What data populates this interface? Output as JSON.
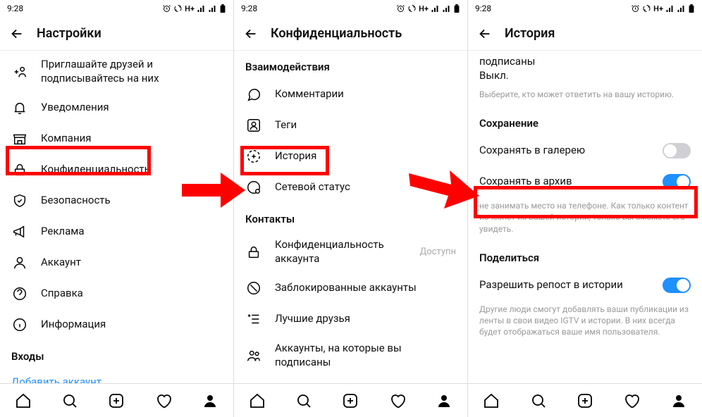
{
  "status": {
    "time": "9:28",
    "net": "H+"
  },
  "screen1": {
    "title": "Настройки",
    "rows": [
      {
        "label": "Приглашайте друзей и подписывайтесь на них"
      },
      {
        "label": "Уведомления"
      },
      {
        "label": "Компания"
      },
      {
        "label": "Конфиденциальность"
      },
      {
        "label": "Безопасность"
      },
      {
        "label": "Реклама"
      },
      {
        "label": "Аккаунт"
      },
      {
        "label": "Справка"
      },
      {
        "label": "Информация"
      }
    ],
    "logins_header": "Входы",
    "add_account": "Добавить аккаунт"
  },
  "screen2": {
    "title": "Конфиденциальность",
    "section_interactions": "Взаимодействия",
    "rows_i": [
      {
        "label": "Комментарии"
      },
      {
        "label": "Теги"
      },
      {
        "label": "История"
      },
      {
        "label": "Сетевой статус"
      }
    ],
    "section_contacts": "Контакты",
    "rows_c": [
      {
        "label": "Конфиденциальность аккаунта",
        "trailing": "Доступн"
      },
      {
        "label": "Заблокированные аккаунты"
      },
      {
        "label": "Лучшие друзья"
      },
      {
        "label": "Аккаунты, на которые вы подписаны"
      }
    ]
  },
  "screen3": {
    "title": "История",
    "top_cut": "подписаны",
    "top_val": "Выкл.",
    "top_hint": "Выберите, кто может ответить на вашу историю.",
    "section_save": "Сохранение",
    "save_gallery": "Сохранять в галерею",
    "save_archive": "Сохранять в архив",
    "archive_hint": "не занимать место на телефоне. Как только контент исчезнет из вашей истории, только вы сможете его увидеть.",
    "section_share": "Поделиться",
    "allow_repost": "Разрешить репост в истории",
    "repost_hint": "Другие люди смогут добавлять ваши публикации из ленты в свои видео IGTV и истории. В них всегда будет отображаться ваше имя пользователя."
  }
}
